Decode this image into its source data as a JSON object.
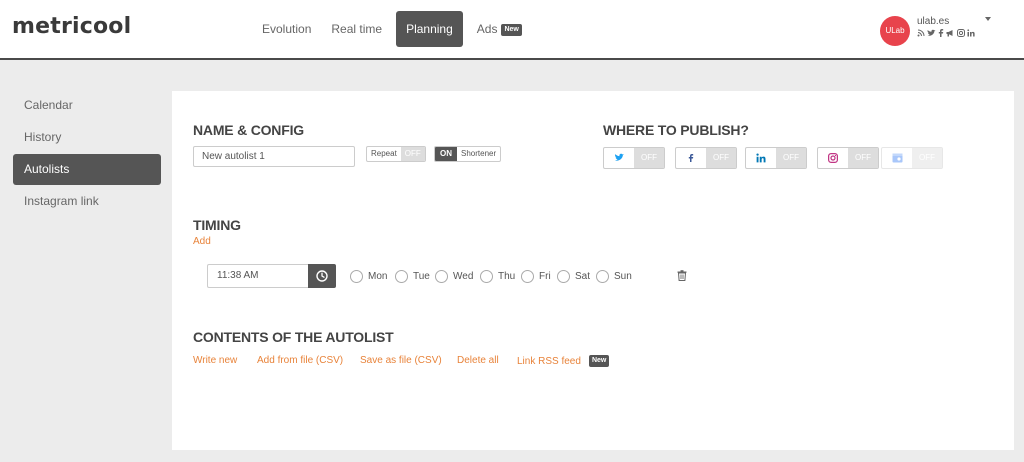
{
  "app": {
    "logo": "metricool"
  },
  "nav": {
    "items": [
      {
        "label": "Evolution"
      },
      {
        "label": "Real time"
      },
      {
        "label": "Planning"
      },
      {
        "label": "Ads"
      }
    ],
    "ads_badge": "New"
  },
  "account": {
    "avatar_text": "ULab",
    "name": "ulab.es",
    "icons": [
      "rss-icon",
      "twitter-icon",
      "facebook-icon",
      "megaphone-icon",
      "instagram-icon",
      "linkedin-icon"
    ]
  },
  "sidebar": {
    "items": [
      {
        "label": "Calendar"
      },
      {
        "label": "History"
      },
      {
        "label": "Autolists"
      },
      {
        "label": "Instagram link"
      }
    ]
  },
  "name_config": {
    "title": "NAME & CONFIG",
    "name_value": "New autolist 1",
    "repeat_label": "Repeat",
    "repeat_state": "OFF",
    "shortener_state": "ON",
    "shortener_label": "Shortener"
  },
  "publish": {
    "title": "WHERE TO PUBLISH?",
    "off_label": "OFF",
    "networks": [
      "twitter",
      "facebook",
      "linkedin",
      "instagram",
      "google-my-business"
    ]
  },
  "timing": {
    "title": "TIMING",
    "add_label": "Add",
    "time_value": "11:38 AM",
    "days": [
      "Mon",
      "Tue",
      "Wed",
      "Thu",
      "Fri",
      "Sat",
      "Sun"
    ]
  },
  "contents": {
    "title": "CONTENTS OF THE AUTOLIST",
    "links": [
      "Write new",
      "Add from file (CSV)",
      "Save as file (CSV)",
      "Delete all",
      "Link RSS feed"
    ],
    "rss_badge": "New"
  },
  "colors": {
    "accent": "#e8833a",
    "dark": "#555555",
    "twitter": "#1da1f2",
    "facebook": "#3b5998",
    "linkedin": "#0077b5",
    "instagram": "#c13584",
    "avatar": "#e8434c"
  }
}
